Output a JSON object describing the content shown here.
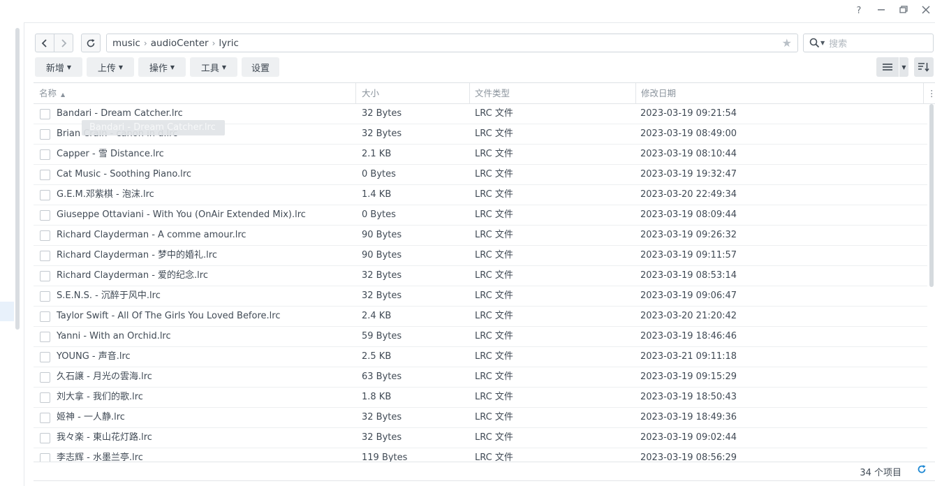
{
  "window": {
    "help_icon": "question-icon",
    "minimize_icon": "minimize-icon",
    "restore_icon": "restore-icon",
    "close_icon": "close-icon"
  },
  "nav": {
    "back_icon": "chevron-left-icon",
    "forward_icon": "chevron-right-icon",
    "refresh_icon": "refresh-icon"
  },
  "path": {
    "segments": [
      "music",
      "audioCenter",
      "lyric"
    ],
    "favorite_icon": "star-icon"
  },
  "search": {
    "placeholder": "搜索"
  },
  "toolbar": {
    "new_label": "新增",
    "upload_label": "上传",
    "action_label": "操作",
    "tools_label": "工具",
    "settings_label": "设置"
  },
  "columns": {
    "name": "名称",
    "size": "大小",
    "type": "文件类型",
    "modified": "修改日期"
  },
  "tooltip": "Bandari - Dream Catcher.lrc",
  "files": [
    {
      "name": "Bandari - Dream Catcher.lrc",
      "size": "32 Bytes",
      "type": "LRC 文件",
      "modified": "2023-03-19 09:21:54"
    },
    {
      "name": "Brian Crain - canon in d.lrc",
      "size": "32 Bytes",
      "type": "LRC 文件",
      "modified": "2023-03-19 08:49:00"
    },
    {
      "name": "Capper - 雪 Distance.lrc",
      "size": "2.1 KB",
      "type": "LRC 文件",
      "modified": "2023-03-19 08:10:44"
    },
    {
      "name": "Cat Music - Soothing Piano.lrc",
      "size": "0 Bytes",
      "type": "LRC 文件",
      "modified": "2023-03-19 19:32:47"
    },
    {
      "name": "G.E.M.邓紫棋 - 泡沫.lrc",
      "size": "1.4 KB",
      "type": "LRC 文件",
      "modified": "2023-03-20 22:49:34"
    },
    {
      "name": "Giuseppe Ottaviani - With You (OnAir Extended Mix).lrc",
      "size": "0 Bytes",
      "type": "LRC 文件",
      "modified": "2023-03-19 08:09:44"
    },
    {
      "name": "Richard Clayderman - A comme amour.lrc",
      "size": "90 Bytes",
      "type": "LRC 文件",
      "modified": "2023-03-19 09:26:32"
    },
    {
      "name": "Richard Clayderman - 梦中的婚礼.lrc",
      "size": "90 Bytes",
      "type": "LRC 文件",
      "modified": "2023-03-19 09:11:57"
    },
    {
      "name": "Richard Clayderman - 爱的纪念.lrc",
      "size": "32 Bytes",
      "type": "LRC 文件",
      "modified": "2023-03-19 08:53:14"
    },
    {
      "name": "S.E.N.S. - 沉醉于风中.lrc",
      "size": "32 Bytes",
      "type": "LRC 文件",
      "modified": "2023-03-19 09:06:47"
    },
    {
      "name": "Taylor Swift - All Of The Girls You Loved Before.lrc",
      "size": "2.4 KB",
      "type": "LRC 文件",
      "modified": "2023-03-20 21:20:42"
    },
    {
      "name": "Yanni - With an Orchid.lrc",
      "size": "59 Bytes",
      "type": "LRC 文件",
      "modified": "2023-03-19 18:46:46"
    },
    {
      "name": "YOUNG - 声音.lrc",
      "size": "2.5 KB",
      "type": "LRC 文件",
      "modified": "2023-03-21 09:11:18"
    },
    {
      "name": "久石譲 - 月光の雲海.lrc",
      "size": "63 Bytes",
      "type": "LRC 文件",
      "modified": "2023-03-19 09:15:29"
    },
    {
      "name": "刘大拿 - 我们的歌.lrc",
      "size": "1.8 KB",
      "type": "LRC 文件",
      "modified": "2023-03-19 18:50:43"
    },
    {
      "name": "姬神 - 一人静.lrc",
      "size": "32 Bytes",
      "type": "LRC 文件",
      "modified": "2023-03-19 18:49:36"
    },
    {
      "name": "我々楽 - 東山花灯路.lrc",
      "size": "32 Bytes",
      "type": "LRC 文件",
      "modified": "2023-03-19 09:02:44"
    },
    {
      "name": "李志辉 - 水墨兰亭.lrc",
      "size": "119 Bytes",
      "type": "LRC 文件",
      "modified": "2023-03-19 08:56:29"
    }
  ],
  "footer": {
    "item_count": "34 个项目"
  }
}
